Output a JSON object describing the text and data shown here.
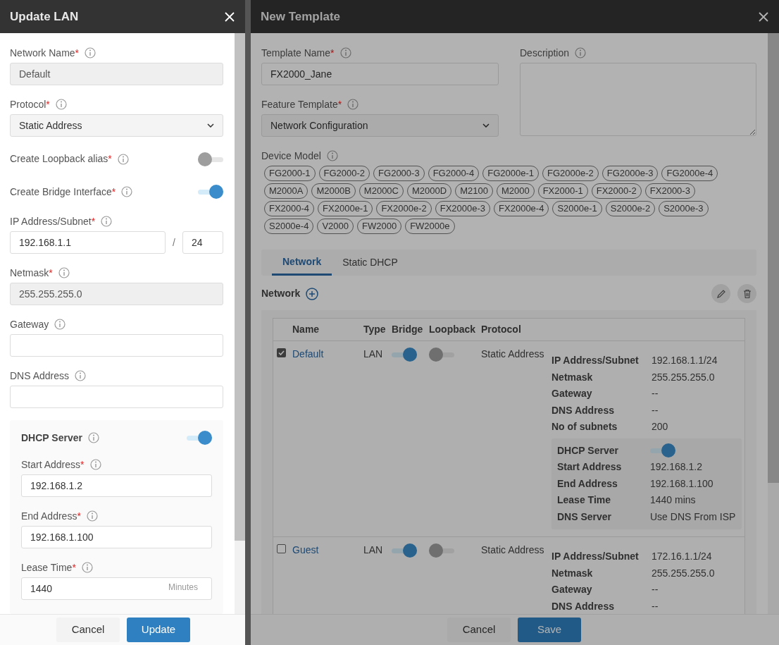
{
  "update_lan": {
    "title": "Update LAN",
    "fields": [
      {
        "kind": "input",
        "label": "Network Name",
        "mark": "*",
        "disabled": true,
        "value": "Default"
      },
      {
        "kind": "select",
        "label": "Protocol",
        "mark": "*",
        "value": "Static Address"
      },
      {
        "kind": "toggle",
        "label": "Create Loopback alias",
        "mark": "*",
        "on": false
      },
      {
        "kind": "toggle",
        "label": "Create Bridge Interface",
        "mark": "*",
        "on": true
      },
      {
        "kind": "subnet",
        "label": "IP Address/Subnet",
        "mark": "*",
        "value": "192.168.1.1",
        "separator": "/",
        "prefix": "24"
      },
      {
        "kind": "input",
        "label": "Netmask",
        "mark": "*",
        "disabled": true,
        "value": "255.255.255.0"
      },
      {
        "kind": "input",
        "label": "Gateway",
        "disabled": false
      },
      {
        "kind": "input",
        "label": "DNS Address",
        "disabled": false
      }
    ],
    "dhcp": {
      "label": "DHCP Server",
      "on": true,
      "fields": [
        {
          "kind": "input",
          "label": "Start Address",
          "mark": "*",
          "disabled": false,
          "value": "192.168.1.2"
        },
        {
          "kind": "input",
          "label": "End Address",
          "mark": "*",
          "disabled": false,
          "value": "192.168.1.100"
        },
        {
          "kind": "input",
          "label": "Lease Time",
          "mark": "*",
          "disabled": false,
          "value": "1440",
          "suffix": "Minutes"
        }
      ]
    },
    "buttons": [
      {
        "label": "Cancel",
        "kind": "secondary"
      },
      {
        "label": "Update",
        "kind": "primary"
      }
    ]
  },
  "new_template": {
    "title": "New Template",
    "template_name": {
      "label": "Template Name",
      "mark": "*",
      "value": "FX2000_Jane"
    },
    "description": {
      "label": "Description"
    },
    "feature_template": {
      "label": "Feature Template",
      "mark": "*",
      "value": "Network Configuration"
    },
    "device_model": {
      "label": "Device Model",
      "models": [
        "FG2000-1",
        "FG2000-2",
        "FG2000-3",
        "FG2000-4",
        "FG2000e-1",
        "FG2000e-2",
        "FG2000e-3",
        "FG2000e-4",
        "M2000A",
        "M2000B",
        "M2000C",
        "M2000D",
        "M2100",
        "M2000",
        "FX2000-1",
        "FX2000-2",
        "FX2000-3",
        "FX2000-4",
        "FX2000e-1",
        "FX2000e-2",
        "FX2000e-3",
        "FX2000e-4",
        "S2000e-1",
        "S2000e-2",
        "S2000e-3",
        "S2000e-4",
        "V2000",
        "FW2000",
        "FW2000e"
      ]
    },
    "tabs": [
      {
        "label": "Network",
        "selected": true
      },
      {
        "label": "Static DHCP",
        "selected": false
      }
    ],
    "network": {
      "title": "Network",
      "columns": [
        "Name",
        "Type",
        "Bridge",
        "Loopback",
        "Protocol"
      ],
      "rows": [
        {
          "name": "Default",
          "checked": true,
          "type": "LAN",
          "bridge": true,
          "loopback": false,
          "protocol": "Static Address",
          "details": [
            {
              "label": "IP Address/Subnet",
              "value": "192.168.1.1/24"
            },
            {
              "label": "Netmask",
              "value": "255.255.255.0"
            },
            {
              "label": "Gateway",
              "value": "--"
            },
            {
              "label": "DNS Address",
              "value": "--"
            },
            {
              "label": "No of subnets",
              "value": "200"
            }
          ],
          "dhcp": {
            "label": "DHCP Server",
            "on": true,
            "details": [
              {
                "label": "Start Address",
                "value": "192.168.1.2"
              },
              {
                "label": "End Address",
                "value": "192.168.1.100"
              },
              {
                "label": "Lease Time",
                "value": "1440 mins"
              },
              {
                "label": "DNS Server",
                "value": "Use DNS From ISP"
              }
            ]
          }
        },
        {
          "name": "Guest",
          "checked": false,
          "type": "LAN",
          "bridge": true,
          "loopback": false,
          "protocol": "Static Address",
          "details": [
            {
              "label": "IP Address/Subnet",
              "value": "172.16.1.1/24"
            },
            {
              "label": "Netmask",
              "value": "255.255.255.0"
            },
            {
              "label": "Gateway",
              "value": "--"
            },
            {
              "label": "DNS Address",
              "value": "--"
            }
          ]
        }
      ]
    },
    "buttons": [
      {
        "label": "Cancel",
        "kind": "secondary"
      },
      {
        "label": "Save",
        "kind": "primary"
      }
    ]
  }
}
